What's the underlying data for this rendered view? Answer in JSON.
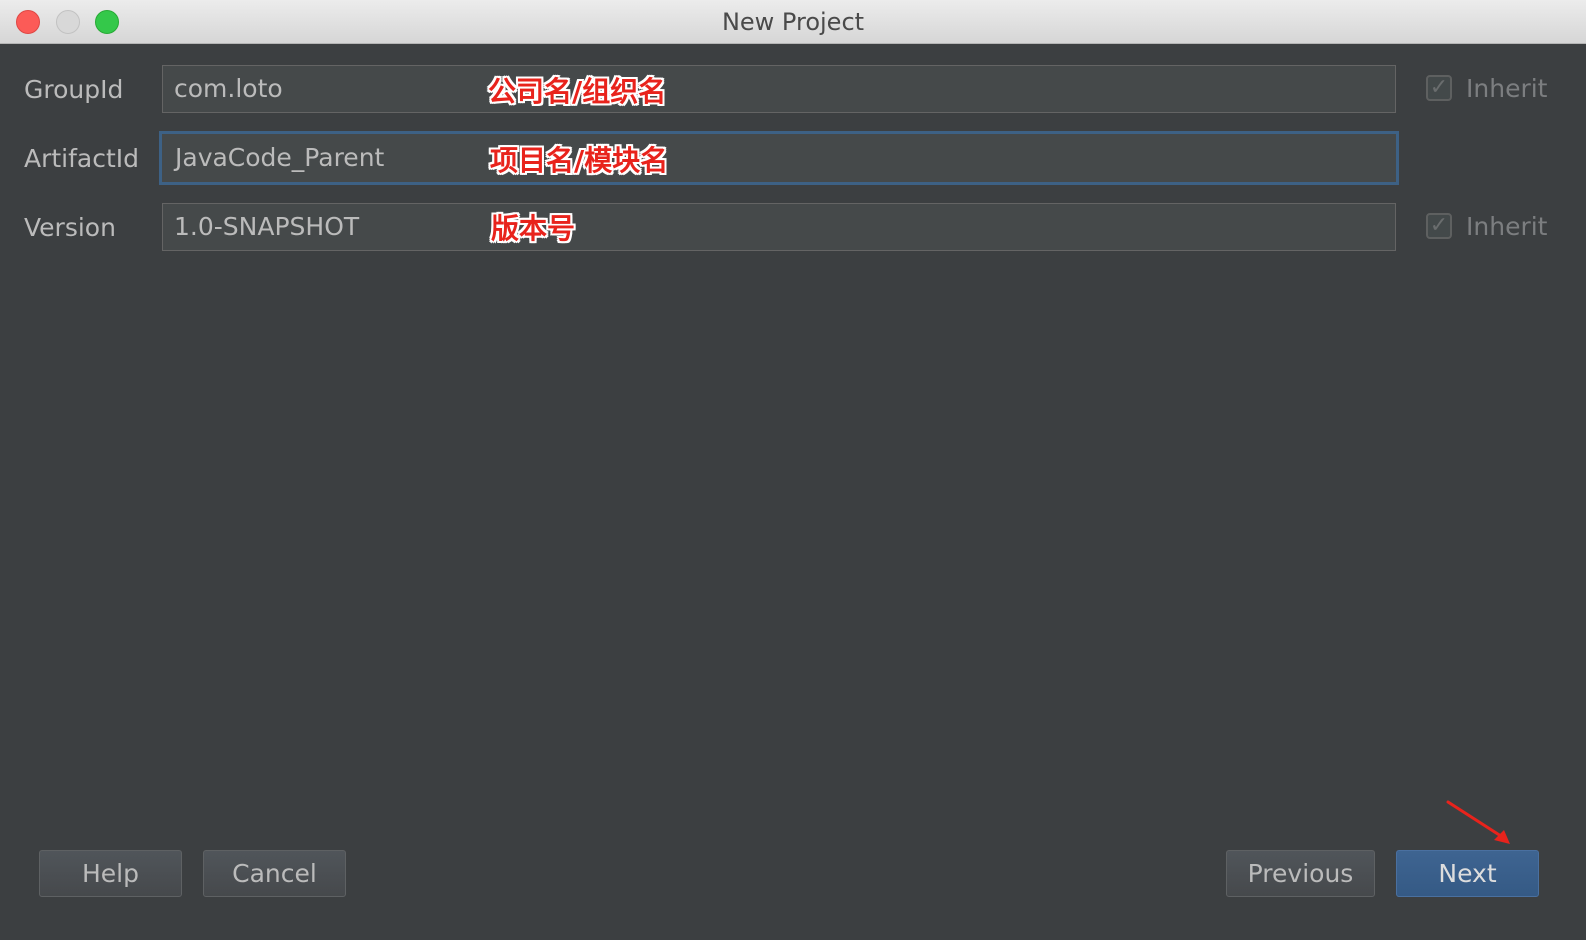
{
  "window": {
    "title": "New Project"
  },
  "form": {
    "groupId": {
      "label": "GroupId",
      "value": "com.loto",
      "annotation": "公司名/组织名",
      "inherit_label": "Inherit",
      "inherit_checked": true
    },
    "artifactId": {
      "label": "ArtifactId",
      "value": "JavaCode_Parent",
      "annotation": "项目名/模块名"
    },
    "version": {
      "label": "Version",
      "value": "1.0-SNAPSHOT",
      "annotation": "版本号",
      "inherit_label": "Inherit",
      "inherit_checked": true
    }
  },
  "buttons": {
    "help": "Help",
    "cancel": "Cancel",
    "previous": "Previous",
    "next": "Next"
  },
  "icons": {
    "check": "✓",
    "arrow": "arrow-icon"
  },
  "colors": {
    "background": "#3c3f41",
    "annotation": "#e8231c",
    "focus": "#3d6185",
    "default_button": "#365880"
  }
}
